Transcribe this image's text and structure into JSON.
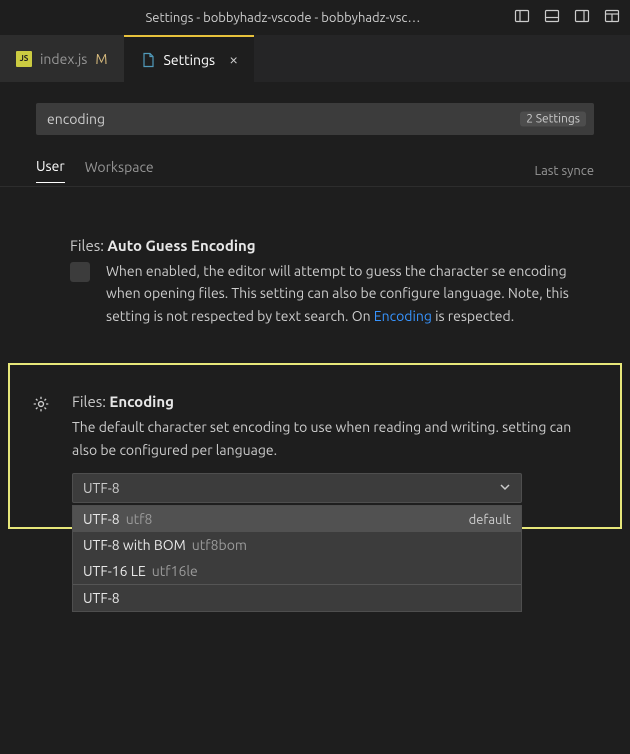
{
  "titleBar": {
    "title": "Settings - bobbyhadz-vscode - bobbyhadz-vsc…"
  },
  "tabs": [
    {
      "label": "index.js",
      "modified": "M",
      "active": false,
      "iconLabel": "JS",
      "iconBg": "#cbcb41"
    },
    {
      "label": "Settings",
      "modified": "",
      "active": true
    }
  ],
  "search": {
    "value": "encoding",
    "count": "2 Settings"
  },
  "scopeTabs": {
    "items": [
      {
        "label": "User",
        "active": true
      },
      {
        "label": "Workspace",
        "active": false
      }
    ],
    "lastSync": "Last synce"
  },
  "settings": {
    "autoGuess": {
      "category": "Files:",
      "name": "Auto Guess Encoding",
      "descPre": "When enabled, the editor will attempt to guess the character se encoding when opening files. This setting can also be configure language. Note, this setting is not respected by text search. On ",
      "link": "Encoding",
      "descPost": " is respected."
    },
    "encoding": {
      "category": "Files:",
      "name": "Encoding",
      "desc": "The default character set encoding to use when reading and writing. setting can also be configured per language.",
      "selected": "UTF-8",
      "options": [
        {
          "label": "UTF-8",
          "alias": "utf8",
          "badge": "default",
          "selected": true
        },
        {
          "label": "UTF-8 with BOM",
          "alias": "utf8bom",
          "badge": "",
          "selected": false
        },
        {
          "label": "UTF-16 LE",
          "alias": "utf16le",
          "badge": "",
          "selected": false
        }
      ],
      "filter": "UTF-8"
    }
  }
}
